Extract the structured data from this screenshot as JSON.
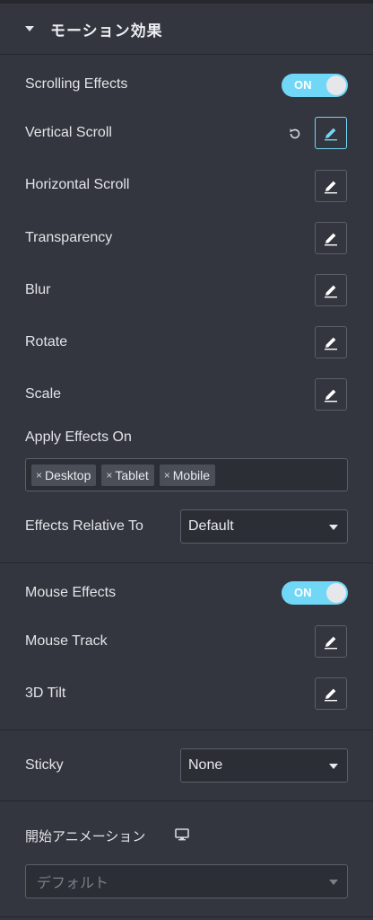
{
  "section": {
    "title": "モーション効果"
  },
  "scrolling": {
    "label": "Scrolling Effects",
    "toggle": "ON",
    "items": [
      {
        "label": "Vertical Scroll",
        "active": true
      },
      {
        "label": "Horizontal Scroll"
      },
      {
        "label": "Transparency"
      },
      {
        "label": "Blur"
      },
      {
        "label": "Rotate"
      },
      {
        "label": "Scale"
      }
    ],
    "apply_label": "Apply Effects On",
    "apply_tags": [
      "Desktop",
      "Tablet",
      "Mobile"
    ],
    "relative_label": "Effects Relative To",
    "relative_value": "Default"
  },
  "mouse": {
    "label": "Mouse Effects",
    "toggle": "ON",
    "items": [
      {
        "label": "Mouse Track"
      },
      {
        "label": "3D Tilt"
      }
    ]
  },
  "sticky": {
    "label": "Sticky",
    "value": "None"
  },
  "entrance": {
    "label": "開始アニメーション",
    "value": "デフォルト"
  },
  "colors": {
    "accent": "#71d7f7",
    "panel": "#33363e",
    "border": "#5b5f68"
  },
  "icons": [
    "caret-down-icon",
    "reset-icon",
    "pencil-icon",
    "desktop-icon",
    "chevron-down-icon"
  ]
}
